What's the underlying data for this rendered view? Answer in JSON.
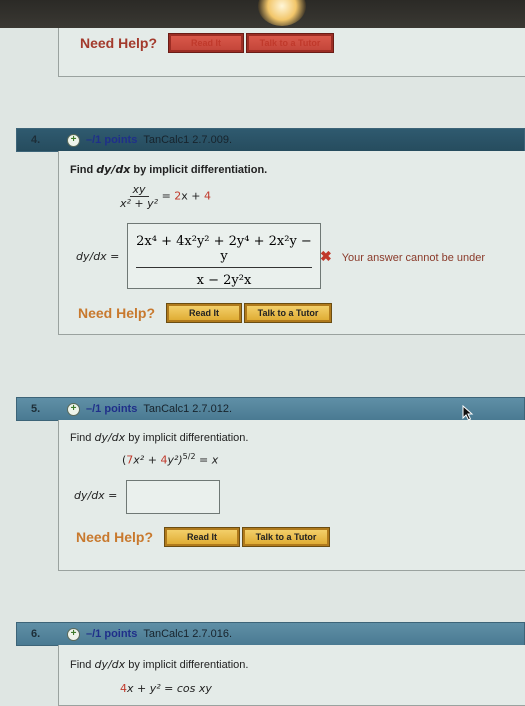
{
  "previous_question": {
    "need_help_label": "Need Help?",
    "read_it_label": "Read It",
    "tutor_label": "Talk to a Tutor"
  },
  "questions": [
    {
      "number": "4.",
      "points": "–/1 points",
      "code": "TanCalc1 2.7.009.",
      "prompt_prefix": "Find",
      "prompt_var": "dy/dx",
      "prompt_suffix": "by implicit differentiation.",
      "equation": {
        "lhs_numerator": "xy",
        "lhs_denominator": "x² + y²",
        "equals": "=",
        "rhs_coef": "2",
        "rhs_var": "x +",
        "rhs_const": "4"
      },
      "answer_label": "dy/dx =",
      "answer_numerator": "2x⁴ + 4x²y² + 2y⁴ + 2x²y − y",
      "answer_denominator": "x − 2y²x",
      "feedback": "Your answer cannot be under",
      "feedback_icon": "x-mark-icon",
      "need_help_label": "Need Help?",
      "read_it_label": "Read It",
      "tutor_label": "Talk to a Tutor"
    },
    {
      "number": "5.",
      "points": "–/1 points",
      "code": "TanCalc1 2.7.012.",
      "prompt_prefix": "Find",
      "prompt_var": "dy/dx",
      "prompt_suffix": "by implicit differentiation.",
      "equation": {
        "open": "(",
        "coef1": "7",
        "term1": "x² +",
        "coef2": "4",
        "term2": "y²)",
        "exponent": "5/2",
        "rhs": "= x"
      },
      "answer_label": "dy/dx =",
      "answer_value": "",
      "need_help_label": "Need Help?",
      "read_it_label": "Read It",
      "tutor_label": "Talk to a Tutor"
    },
    {
      "number": "6.",
      "points": "–/1 points",
      "code": "TanCalc1 2.7.016.",
      "prompt_prefix": "Find",
      "prompt_var": "dy/dx",
      "prompt_suffix": "by implicit differentiation.",
      "equation": {
        "coef1": "4",
        "rest": "x + y² = cos xy"
      }
    }
  ]
}
